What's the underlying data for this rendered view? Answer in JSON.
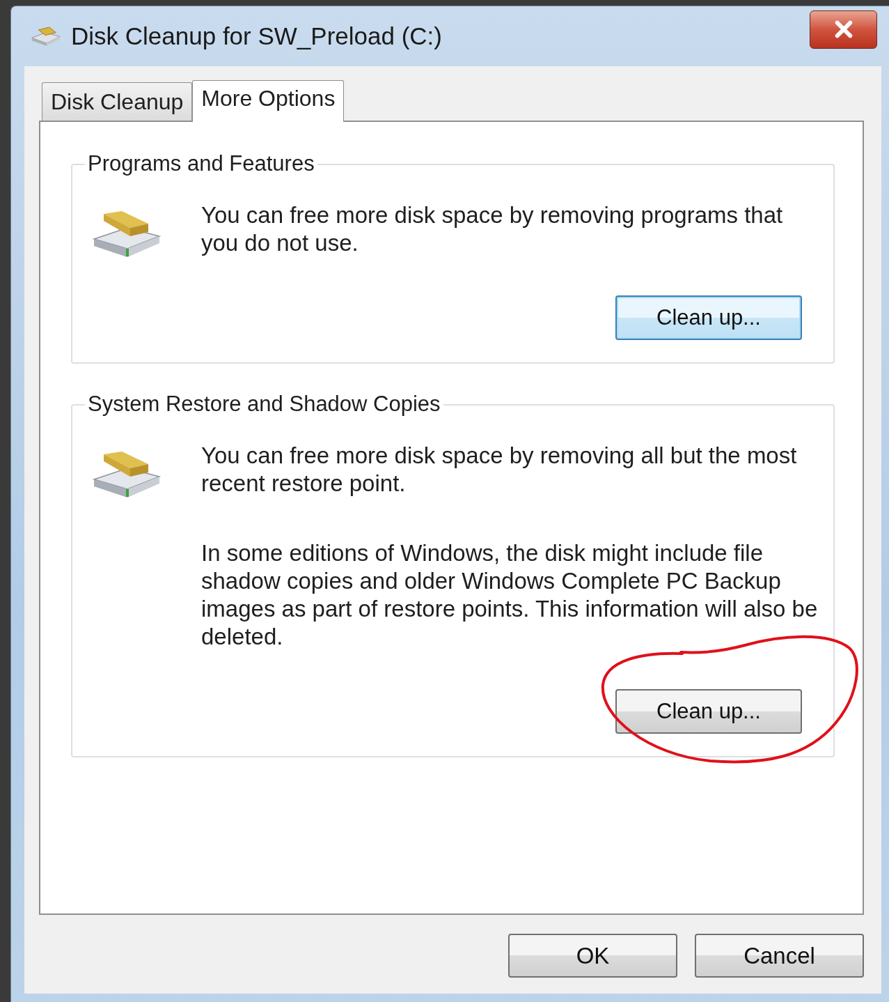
{
  "window": {
    "title": "Disk Cleanup for SW_Preload (C:)"
  },
  "tabs": [
    {
      "label": "Disk Cleanup",
      "selected": false
    },
    {
      "label": "More Options",
      "selected": true
    }
  ],
  "groups": [
    {
      "title": "Programs and Features",
      "paragraphs": [
        "You can free more disk space by removing programs that you do not use."
      ],
      "button": {
        "label": "Clean up...",
        "focused": true
      },
      "annotated": false
    },
    {
      "title": "System Restore and Shadow Copies",
      "paragraphs": [
        "You can free more disk space by removing all but the most recent restore point.",
        "In some editions of Windows, the disk might include file shadow copies and older Windows Complete PC Backup images as part of restore points. This information will also be deleted."
      ],
      "button": {
        "label": "Clean up...",
        "focused": false
      },
      "annotated": true
    }
  ],
  "buttons": [
    "OK",
    "Cancel"
  ]
}
